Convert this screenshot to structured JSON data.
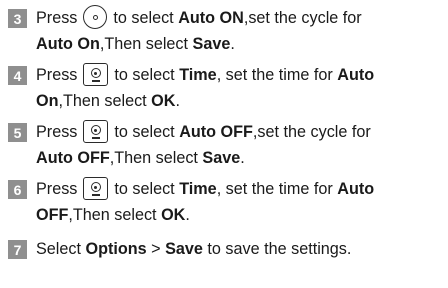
{
  "steps": [
    {
      "number": "3",
      "l1_a": "Press",
      "icon": "ok-center-icon",
      "l1_b": "to select",
      "l1_c": "Auto ON",
      "l1_d": ",set the cycle for",
      "l2_a": "Auto On",
      "l2_b": ",Then select",
      "l2_c": "Save",
      "l2_d": "."
    },
    {
      "number": "4",
      "l1_a": "Press",
      "icon": "ok-key-icon",
      "l1_b": "to select",
      "l1_c": "Time",
      "l1_d": ", set the time for",
      "l1_e": "Auto",
      "l2_a": "On",
      "l2_b": ",Then select",
      "l2_c": "OK",
      "l2_d": "."
    },
    {
      "number": "5",
      "l1_a": "Press",
      "icon": "ok-key-icon",
      "l1_b": "to select",
      "l1_c": "Auto OFF",
      "l1_d": ",set the cycle for",
      "l2_a": "Auto OFF",
      "l2_b": ",Then select",
      "l2_c": "Save",
      "l2_d": "."
    },
    {
      "number": "6",
      "l1_a": "Press",
      "icon": "ok-key-icon",
      "l1_b": "to select",
      "l1_c": "Time",
      "l1_d": ", set the time for",
      "l1_e": "Auto",
      "l2_a": "OFF",
      "l2_b": ",Then select",
      "l2_c": "OK",
      "l2_d": "."
    },
    {
      "number": "7",
      "l1_a": "Select",
      "l1_b": "Options",
      "l1_c": " > ",
      "l1_d": "Save",
      "l1_e": " to save the settings."
    }
  ],
  "colors": {
    "badge_bg": "#8f8f8f",
    "badge_text": "#ffffff",
    "text": "#1a1a1a"
  }
}
